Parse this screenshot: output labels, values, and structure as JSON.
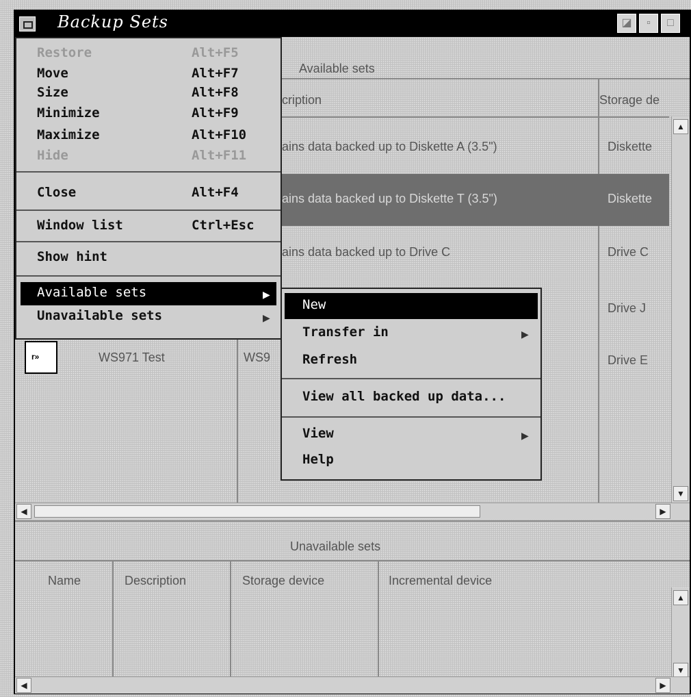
{
  "window": {
    "title": "Backup Sets"
  },
  "available": {
    "header": "Available sets",
    "columns": [
      "cription",
      "Storage de"
    ],
    "rows": [
      {
        "description": "ains data backed up to Diskette A (3.5\")",
        "device": "Diskette"
      },
      {
        "description": "ains data backed up to Diskette T (3.5\")",
        "device": "Diskette"
      },
      {
        "description": "ains data backed up to Drive C",
        "device": "Drive C"
      },
      {
        "description": "",
        "device": "Drive J"
      },
      {
        "description": "",
        "device": "Drive E"
      }
    ],
    "extra_item": {
      "name": "WS971 Test",
      "description": "WS9"
    }
  },
  "system_menu": {
    "items": [
      {
        "label": "Restore",
        "accel": "Alt+F5",
        "disabled": true
      },
      {
        "label": "Move",
        "accel": "Alt+F7",
        "disabled": false
      },
      {
        "label": "Size",
        "accel": "Alt+F8",
        "disabled": false
      },
      {
        "label": "Minimize",
        "accel": "Alt+F9",
        "disabled": false
      },
      {
        "label": "Maximize",
        "accel": "Alt+F10",
        "disabled": false
      },
      {
        "label": "Hide",
        "accel": "Alt+F11",
        "disabled": true
      },
      {
        "label": "Close",
        "accel": "Alt+F4",
        "disabled": false
      },
      {
        "label": "Window list",
        "accel": "Ctrl+Esc",
        "disabled": false
      },
      {
        "label": "Show hint",
        "accel": "",
        "disabled": false
      },
      {
        "label": "Available sets",
        "accel": "",
        "disabled": false
      },
      {
        "label": "Unavailable sets",
        "accel": "",
        "disabled": false
      }
    ]
  },
  "submenu": {
    "items": [
      {
        "label": "New"
      },
      {
        "label": "Transfer in"
      },
      {
        "label": "Refresh"
      },
      {
        "label": "View all backed up data..."
      },
      {
        "label": "View"
      },
      {
        "label": "Help"
      }
    ]
  },
  "unavailable": {
    "header": "Unavailable sets",
    "columns": [
      "Name",
      "Description",
      "Storage device",
      "Incremental device"
    ]
  },
  "colors": {
    "titlebar": "#000000",
    "selection": "#6e6e6e",
    "menu_highlight": "#000000"
  }
}
